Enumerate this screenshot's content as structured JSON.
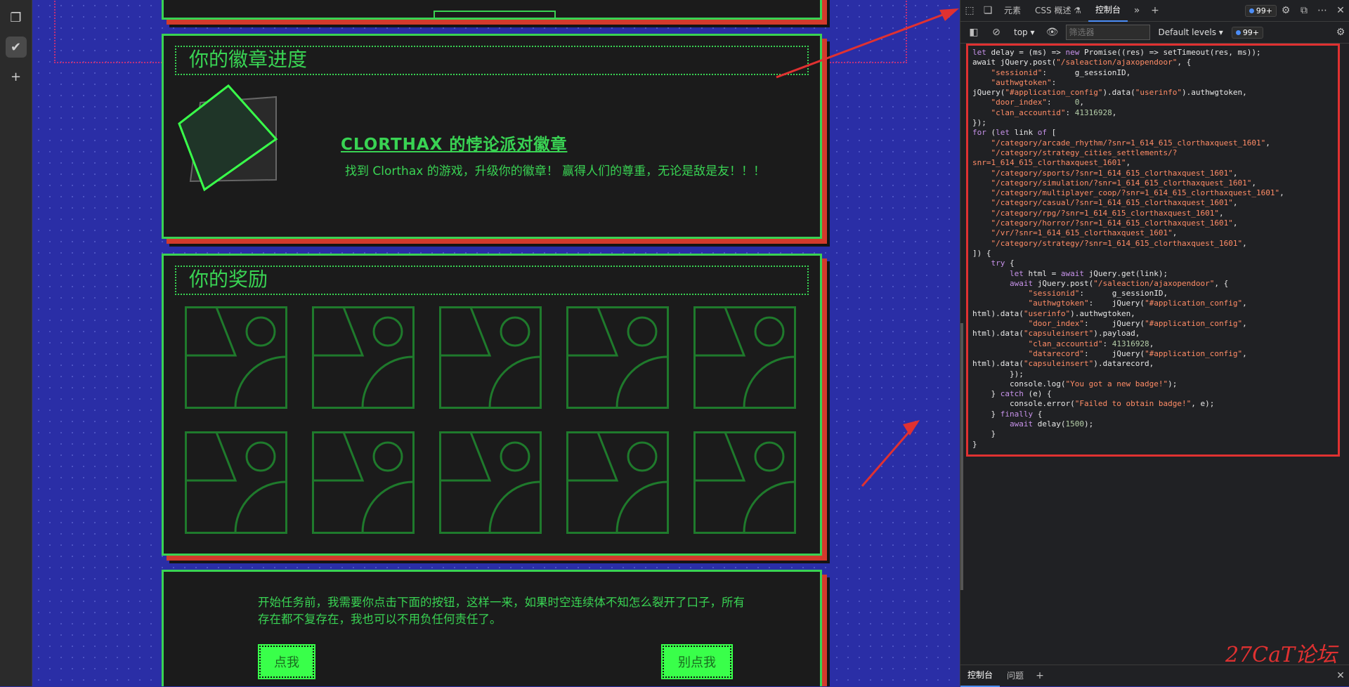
{
  "page": {
    "badge_section": {
      "heading": "你的徽章进度",
      "badge_title": "CLORTHAX 的悖论派对徽章",
      "badge_desc": "找到 Clorthax 的游戏，升级你的徽章！ 赢得人们的尊重，无论是敌是友！！！"
    },
    "rewards_section": {
      "heading": "你的奖励",
      "tile_count": 10
    },
    "mission_section": {
      "text": "开始任务前，我需要你点击下面的按钮，这样一来，如果时空连续体不知怎么裂开了口子，所有存在都不复存在，我也可以不用负任何责任了。",
      "button_primary": "点我",
      "button_secondary": "别点我"
    },
    "colors": {
      "accent": "#39d353",
      "panel_bg": "#1b1b1b",
      "shadow": "#d33a2c",
      "page_bg": "#2a2ea6"
    }
  },
  "devtools": {
    "tabs": [
      "元素",
      "CSS 概述 ⚗",
      "控制台"
    ],
    "active_tab": "控制台",
    "issues_badge": "99+",
    "context_select": "top",
    "filter_placeholder": "筛选器",
    "levels_select": "Default levels",
    "levels_badge": "99+",
    "bottom_tabs": [
      "控制台",
      "问题"
    ]
  },
  "watermark": "27CaT论坛"
}
